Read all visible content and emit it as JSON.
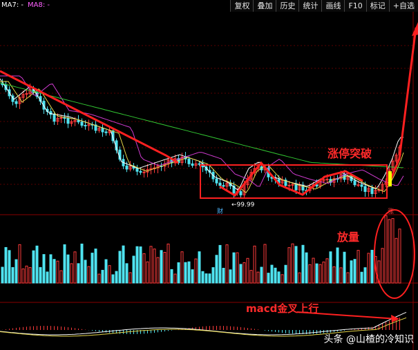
{
  "legend": {
    "ma7": "MA7: -",
    "ma8": "MA8: -"
  },
  "toolbar": {
    "items": [
      "复权",
      "叠加",
      "历史",
      "统计",
      "画线",
      "F10",
      "标记",
      "+自选"
    ],
    "extra": "◀"
  },
  "annotations": {
    "limit_up_breakout": "涨停突破",
    "volume_up": "放量",
    "macd_cross": "macd金叉上行"
  },
  "markers": {
    "low_price": "←99.99",
    "finance_flag": "财",
    "limit_up_flag": "涨"
  },
  "watermark": "头条 @山楂的冷知识",
  "colors": {
    "up": "#ff3b3b",
    "down": "#4fe3f0",
    "annotation": "#ff2020",
    "ma_white": "#ffffff",
    "ma_yellow": "#e8d84a",
    "ma_magenta": "#d23cd2",
    "ma_green": "#33c933"
  }
}
